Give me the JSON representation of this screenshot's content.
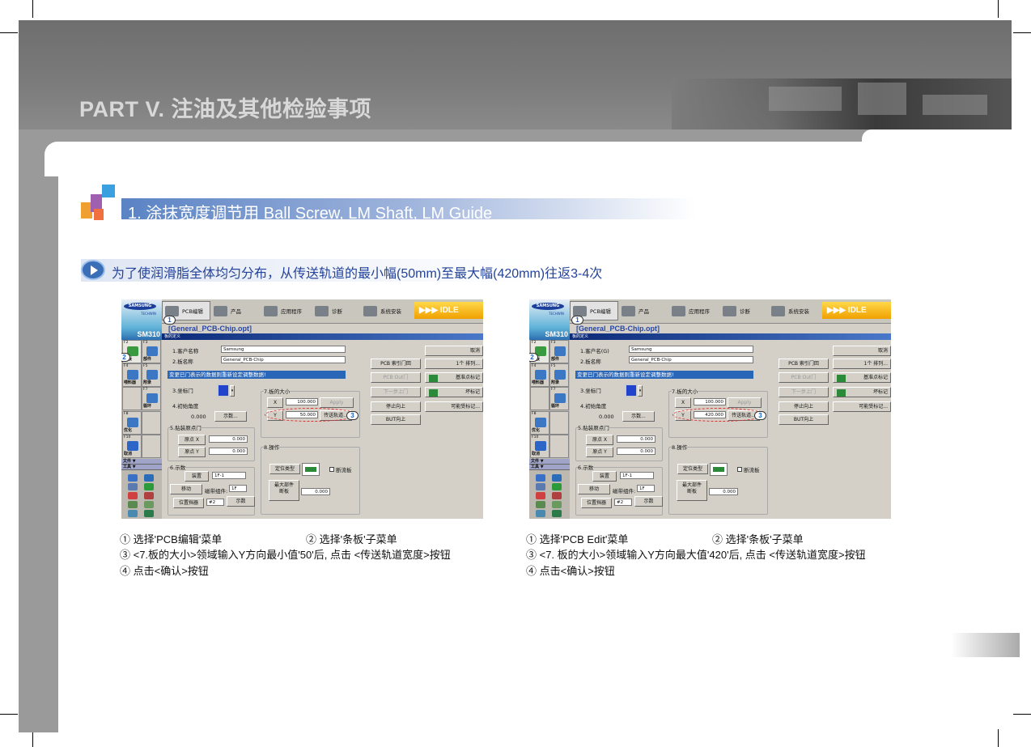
{
  "header": {
    "part_title": "PART V. 注油及其他检验事项"
  },
  "section": {
    "title": "1. 涂抹宽度调节用 Ball Screw, LM Shaft, LM Guide"
  },
  "note": {
    "text": "为了使润滑脂全体均匀分布，从传送轨道的最小幅(50mm)至最大幅(420mm)往返3-4次"
  },
  "colors": {
    "header_gray": "#7c7c7c",
    "section_blue": "#5a83c4",
    "note_text": "#24439a",
    "highlight_blue": "#2a66b8",
    "marker_red": "#e03030"
  },
  "shots": [
    {
      "logo": "SAMSUNG",
      "logo_sub": "TECHWIN",
      "model": "SM310",
      "tabs": [
        "PCB编辑",
        "产品",
        "应用程序",
        "诊断",
        "系统安装"
      ],
      "status": "▶▶▶  IDLE",
      "filename": "[General_PCB-Chip.opt]",
      "window_title": "板的定义",
      "fkeys": [
        {
          "fn": "F2",
          "label": "条板"
        },
        {
          "fn": "F3",
          "label": "部件"
        },
        {
          "fn": "F4",
          "label": "喂料器"
        },
        {
          "fn": "F5",
          "label": "附录"
        },
        {
          "fn": "",
          "label": ""
        },
        {
          "fn": "F7",
          "label": "循环"
        },
        {
          "fn": "F8",
          "label": "优化"
        },
        {
          "fn": "F10",
          "label": "取消"
        }
      ],
      "menu_file": "文件 ▼",
      "menu_tools": "工具 ▼",
      "customer_label": "1.客户名称",
      "customer_value": "Samsung",
      "board_label": "2.板名称",
      "board_value": "General_PCB-Chip",
      "warning": "变更已门表示的数据则重新设定调整数据!",
      "coord_label": "3.坐标门",
      "angle_label": "4.初始角度",
      "angle_value": "0.000",
      "teach_btn": "示数...",
      "size_label": "7.板的大小",
      "x_label": "X",
      "x_value": "100.000",
      "apply": "Apply",
      "y_label": "Y",
      "y_value": "50.000",
      "conveyor_btn": "传送轨道...",
      "origin_label": "5.贴装原点门",
      "ox_label": "原点 X",
      "ox_value": "0.000",
      "oy_label": "原点 Y",
      "oy_value": "0.000",
      "teach_label": "6.示数",
      "device_btn": "装置",
      "device_value": "1F-1",
      "move_btn": "移动",
      "tape_label": "磁带组件:",
      "tape_value": "1F",
      "stopper_btn": "位置挡器",
      "stopper_value": "#2",
      "teach2_btn": "示数",
      "op_label": "8.操作",
      "locate_btn": "定位类型",
      "breakflow": "断流板",
      "maxpart_btn": "最大部件\n断板",
      "maxpart_value": "0.000",
      "right_col1": [
        "PCB 索引门回",
        "PCB Out门",
        "下一步上门",
        "停止向上",
        "BUT向上"
      ],
      "right_col2": [
        "取消",
        "1个  排列...",
        "基准点标记",
        "坏标记",
        "可能受标记..."
      ],
      "markers": [
        "1",
        "2",
        "3"
      ]
    },
    {
      "logo": "SAMSUNG",
      "logo_sub": "TECHWIN",
      "model": "SM310",
      "tabs": [
        "PCB编辑",
        "产品",
        "应用程序",
        "诊断",
        "系统安装"
      ],
      "status": "▶▶▶  IDLE",
      "filename": "[General_PCB-Chip.opt]",
      "window_title": "板的定义",
      "fkeys": [
        {
          "fn": "F2",
          "label": "条板"
        },
        {
          "fn": "F3",
          "label": "部件"
        },
        {
          "fn": "F4",
          "label": "喂料器"
        },
        {
          "fn": "F5",
          "label": "附录"
        },
        {
          "fn": "",
          "label": ""
        },
        {
          "fn": "F7",
          "label": "循环"
        },
        {
          "fn": "F8",
          "label": "优化"
        },
        {
          "fn": "F10",
          "label": "取消"
        }
      ],
      "menu_file": "文件 ▼",
      "menu_tools": "工具 ▼",
      "customer_label": "1.客户名(G)",
      "customer_value": "Samsung",
      "board_label": "2.板名称",
      "board_value": "General_PCB-Chip",
      "warning": "变更已门表示的数据则重新设定调整数据!",
      "coord_label": "3.坐标门",
      "angle_label": "4.初始角度",
      "angle_value": "0.000",
      "teach_btn": "示数...",
      "size_label": "7.板的大小",
      "x_label": "X",
      "x_value": "100.000",
      "apply": "Apply",
      "y_label": "Y",
      "y_value": "420.000",
      "conveyor_btn": "传送轨道...",
      "origin_label": "5.贴装原点门",
      "ox_label": "原点 X",
      "ox_value": "0.000",
      "oy_label": "原点 Y",
      "oy_value": "0.000",
      "teach_label": "6.示数",
      "device_btn": "装置",
      "device_value": "1F-1",
      "move_btn": "移动",
      "tape_label": "磁带组件:",
      "tape_value": "1F",
      "stopper_btn": "位置挡器",
      "stopper_value": "#2",
      "teach2_btn": "示数",
      "op_label": "8.操作",
      "locate_btn": "定位类型",
      "breakflow": "断流板",
      "maxpart_btn": "最大部件\n断板",
      "maxpart_value": "0.000",
      "right_col1": [
        "PCB 索引门回",
        "PCB Out门",
        "下一步上门",
        "停止向上",
        "BUT向上"
      ],
      "right_col2": [
        "取消",
        "1个  排列...",
        "基准点标记",
        "坏标记",
        "可能受标记..."
      ],
      "markers": [
        "1",
        "2",
        "3"
      ]
    }
  ],
  "captions": [
    {
      "step1": "① 选择'PCB编辑'菜单",
      "step2": "② 选择'条板'子菜单",
      "step3": "③ <7.板的大小>领域输入Y方向最小值'50'后, 点击 <传送轨道宽度>按钮",
      "step4": "④ 点击<确认>按钮"
    },
    {
      "step1": "① 选择'PCB Edit'菜单",
      "step2": "② 选择'条板'子菜单",
      "step3": "③ <7. 板的大小>领域输入Y方向最大值'420'后, 点击 <传送轨道宽度>按钮",
      "step4": "④ 点击<确认>按钮"
    }
  ]
}
